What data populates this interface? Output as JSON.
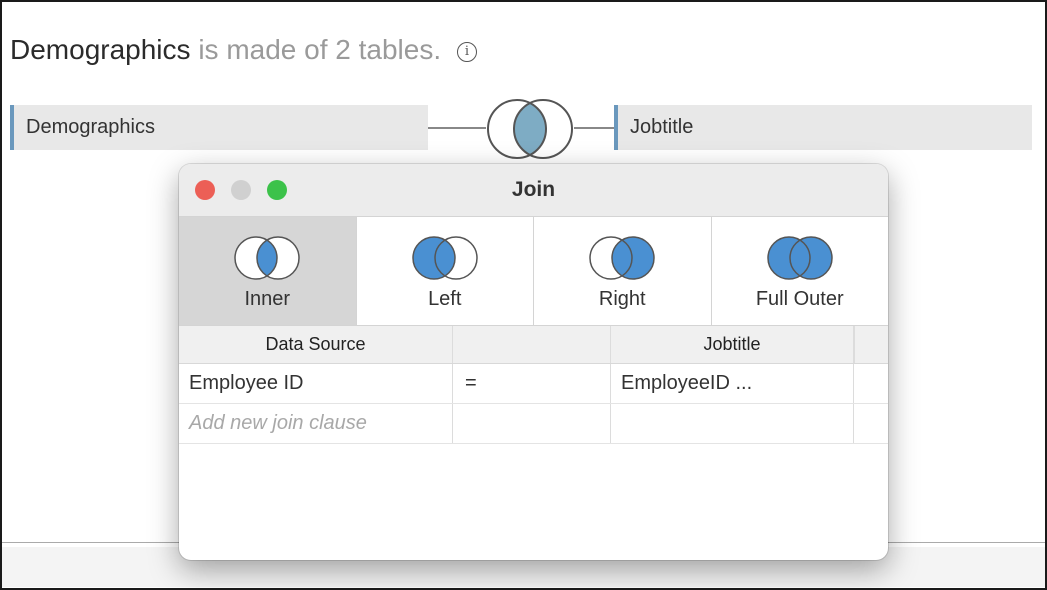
{
  "header": {
    "datasource_name": "Demographics",
    "subtitle": "is made of 2 tables.",
    "info_icon": "info-icon"
  },
  "canvas": {
    "left_table": "Demographics",
    "right_table": "Jobtitle",
    "join_icon": "inner-join-venn-icon"
  },
  "dialog": {
    "title": "Join",
    "join_types": [
      {
        "label": "Inner",
        "icon": "inner-join-icon",
        "selected": true
      },
      {
        "label": "Left",
        "icon": "left-join-icon",
        "selected": false
      },
      {
        "label": "Right",
        "icon": "right-join-icon",
        "selected": false
      },
      {
        "label": "Full Outer",
        "icon": "full-outer-join-icon",
        "selected": false
      }
    ],
    "grid": {
      "headers": [
        "Data Source",
        "",
        "Jobtitle"
      ],
      "rows": [
        {
          "left": "Employee ID",
          "operator": "=",
          "right": "EmployeeID ..."
        }
      ],
      "add_clause_placeholder": "Add new join clause"
    }
  },
  "colors": {
    "accent": "#4a90d2",
    "table_bar": "#6a98bd",
    "venn_fill": "#7eacc4",
    "close": "#ec5f56",
    "maximize": "#3cc24a"
  }
}
